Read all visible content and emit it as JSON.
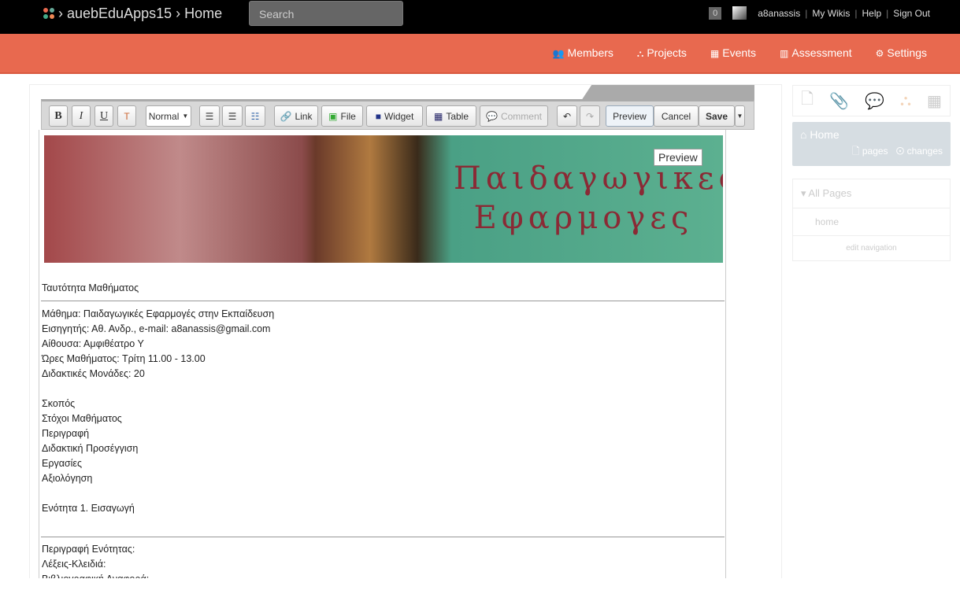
{
  "header": {
    "breadcrumb": "› auebEduApps15 › Home",
    "search_placeholder": "Search",
    "notifications": "0",
    "username": "a8anassis",
    "links": [
      "My Wikis",
      "Help",
      "Sign Out"
    ]
  },
  "nav": [
    {
      "icon": "users-icon",
      "label": "Members"
    },
    {
      "icon": "sitemap-icon",
      "label": "Projects"
    },
    {
      "icon": "calendar-icon",
      "label": "Events"
    },
    {
      "icon": "chart-icon",
      "label": "Assessment"
    },
    {
      "icon": "gear-icon",
      "label": "Settings"
    }
  ],
  "toolbar": {
    "bold": "B",
    "italic": "I",
    "underline": "U",
    "format": "Normal",
    "link": "Link",
    "file": "File",
    "widget": "Widget",
    "table": "Table",
    "comment": "Comment",
    "preview": "Preview",
    "cancel": "Cancel",
    "save": "Save"
  },
  "editor": {
    "banner_text": "Παιδαγωγικες Εφαρμογες",
    "preview_tooltip": "Preview",
    "lines": [
      "Ταυτότητα Μαθήματος",
      "Μάθημα: Παιδαγωγικές Εφαρμογές στην Εκπαίδευση",
      "Εισηγητής: Αθ. Ανδρ., e-mail: a8anassis@gmail.com",
      "Αίθουσα: Αμφιθέατρο Υ",
      "Ώρες Μαθήματος: Τρίτη 11.00 - 13.00",
      "Διδακτικές Μονάδες: 20",
      "Σκοπός",
      "Στόχοι Μαθήματος",
      "Περιγραφή",
      "Διδακτική Προσέγγιση",
      "Εργασίες",
      "Αξιολόγηση",
      "Ενότητα 1. Εισαγωγή",
      "Περιγραφή Ενότητας:",
      "Λέξεις-Κλειδιά:",
      "Βιβλιογραφική Αναφορά:"
    ]
  },
  "sidebar": {
    "home": "Home",
    "pages": "pages",
    "changes": "changes",
    "all_pages": "All Pages",
    "home_link": "home",
    "edit_nav": "edit navigation"
  },
  "colors": {
    "accent": "#e8694f",
    "topbar": "#000000"
  }
}
